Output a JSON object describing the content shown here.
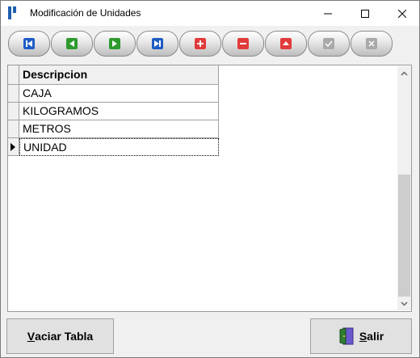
{
  "window": {
    "title": "Modificación de Unidades"
  },
  "titlebar": {
    "minimize_icon": "minimize-icon",
    "maximize_icon": "maximize-icon",
    "close_icon": "close-icon"
  },
  "navigator": {
    "buttons": [
      {
        "name": "first-record-button",
        "icon": "first-icon",
        "color": "#1e5cc4"
      },
      {
        "name": "prior-record-button",
        "icon": "prior-icon",
        "color": "#2e9a2e"
      },
      {
        "name": "next-record-button",
        "icon": "next-icon",
        "color": "#2e9a2e"
      },
      {
        "name": "last-record-button",
        "icon": "last-icon",
        "color": "#1e5cc4"
      },
      {
        "name": "insert-record-button",
        "icon": "plus-icon",
        "color": "#e23a3a"
      },
      {
        "name": "delete-record-button",
        "icon": "minus-icon",
        "color": "#e23a3a"
      },
      {
        "name": "edit-record-button",
        "icon": "up-icon",
        "color": "#e23a3a"
      },
      {
        "name": "post-record-button",
        "icon": "check-icon",
        "color": "#a9a9a9"
      },
      {
        "name": "cancel-record-button",
        "icon": "cancel-icon",
        "color": "#a9a9a9"
      }
    ]
  },
  "grid": {
    "column_header": "Descripcion",
    "rows": [
      "CAJA",
      "KILOGRAMOS",
      "METROS",
      "UNIDAD"
    ],
    "selected_row": 3
  },
  "buttons": {
    "vaciar_prefix": "V",
    "vaciar_rest": "aciar Tabla",
    "salir_prefix": "S",
    "salir_rest": "alir"
  }
}
